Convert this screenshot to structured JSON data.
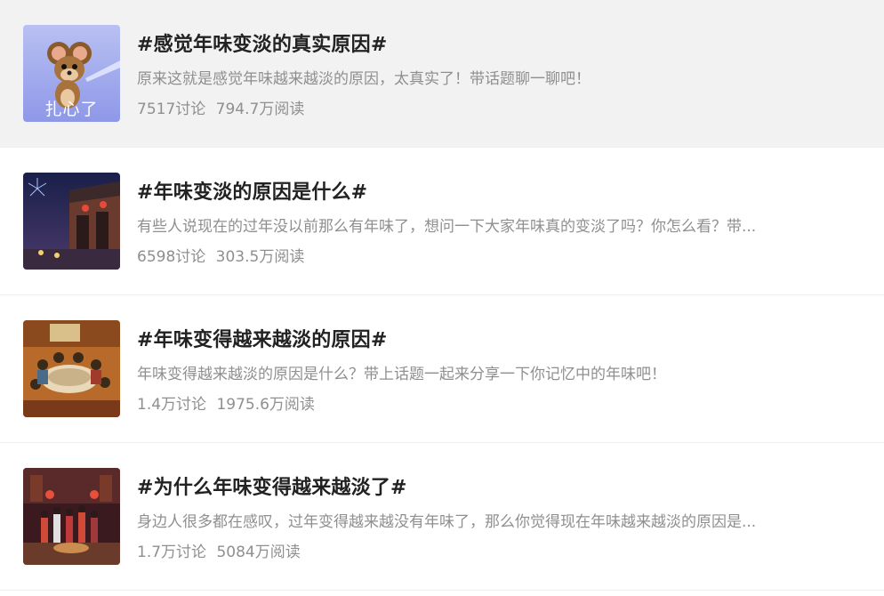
{
  "topics": [
    {
      "title": "#感觉年味变淡的真实原因#",
      "description": "原来这就是感觉年味越来越淡的原因，太真实了！带话题聊一聊吧！",
      "discussions": "7517讨论",
      "reads": "794.7万阅读",
      "thumb_caption": "扎心了",
      "thumb_icon": "cartoon-mouse-icon"
    },
    {
      "title": "#年味变淡的原因是什么#",
      "description": "有些人说现在的过年没以前那么有年味了，想问一下大家年味真的变淡了吗？你怎么看？带...",
      "discussions": "6598讨论",
      "reads": "303.5万阅读",
      "thumb_icon": "fireworks-street-icon"
    },
    {
      "title": "#年味变得越来越淡的原因#",
      "description": "年味变得越来越淡的原因是什么？带上话题一起来分享一下你记忆中的年味吧！",
      "discussions": "1.4万讨论",
      "reads": "1975.6万阅读",
      "thumb_icon": "family-dinner-icon"
    },
    {
      "title": "#为什么年味变得越来越淡了#",
      "description": "身边人很多都在感叹，过年变得越来越没有年味了，那么你觉得现在年味越来越淡的原因是...",
      "discussions": "1.7万讨论",
      "reads": "5084万阅读",
      "thumb_icon": "lantern-courtyard-icon"
    }
  ]
}
